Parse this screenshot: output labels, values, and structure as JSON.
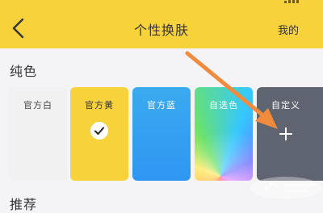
{
  "header": {
    "title": "个性换肤",
    "right_link": "我的",
    "back_icon": "chevron-left-icon",
    "background": "#f8d23a"
  },
  "sections": {
    "solid_title": "纯色",
    "recommend_title": "推荐"
  },
  "skins": [
    {
      "label": "官方白",
      "color": "#f1f1f1"
    },
    {
      "label": "官方黄",
      "color": "#f8d23a",
      "selected": true
    },
    {
      "label": "官方蓝",
      "color": "#2f96f2"
    },
    {
      "label": "自选色",
      "color": "rainbow"
    },
    {
      "label": "自定义",
      "color": "#5f6570",
      "icon": "plus-icon"
    }
  ],
  "annotation": {
    "arrow_color": "#f08a3c"
  }
}
